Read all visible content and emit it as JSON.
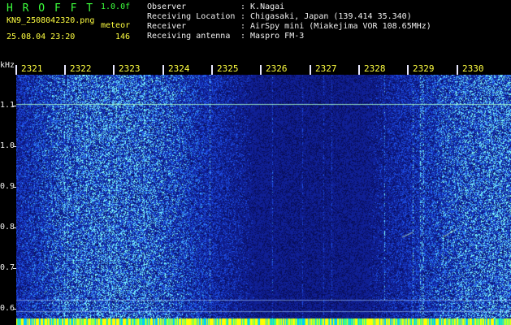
{
  "header": {
    "title": "H R O F F T",
    "version": "1.0.0f",
    "filename": "KN9_2508042320.png",
    "meteor_label": "meteor",
    "timestamp": "25.08.04 23:20",
    "meteor_count": "146"
  },
  "info": [
    {
      "label": "Observer",
      "value": ": K.Nagai"
    },
    {
      "label": "Receiving Location",
      "value": ": Chigasaki, Japan (139.414 35.340)"
    },
    {
      "label": "Receiver",
      "value": ": AirSpy mini (Miakejima VOR 108.65MHz)"
    },
    {
      "label": "Receiving antenna",
      "value": ": Maspro FM-3"
    }
  ],
  "spectrogram": {
    "y_unit": "kHz",
    "y_labels": [
      "1.1",
      "1.0",
      "0.9",
      "0.8",
      "0.7",
      "0.6"
    ],
    "time_labels": [
      "2321",
      "2322",
      "2323",
      "2324",
      "2325",
      "2326",
      "2327",
      "2328",
      "2329",
      "2330"
    ]
  },
  "colors": {
    "background": "#000000",
    "spectrum_base": "#1020a0",
    "spectrum_noise": "#2040ff",
    "spectrum_hot": "#80ffff",
    "header_green": "#3cff3c",
    "tick_yellow": "#ffff40",
    "bottom_strip": "#ffff00"
  }
}
